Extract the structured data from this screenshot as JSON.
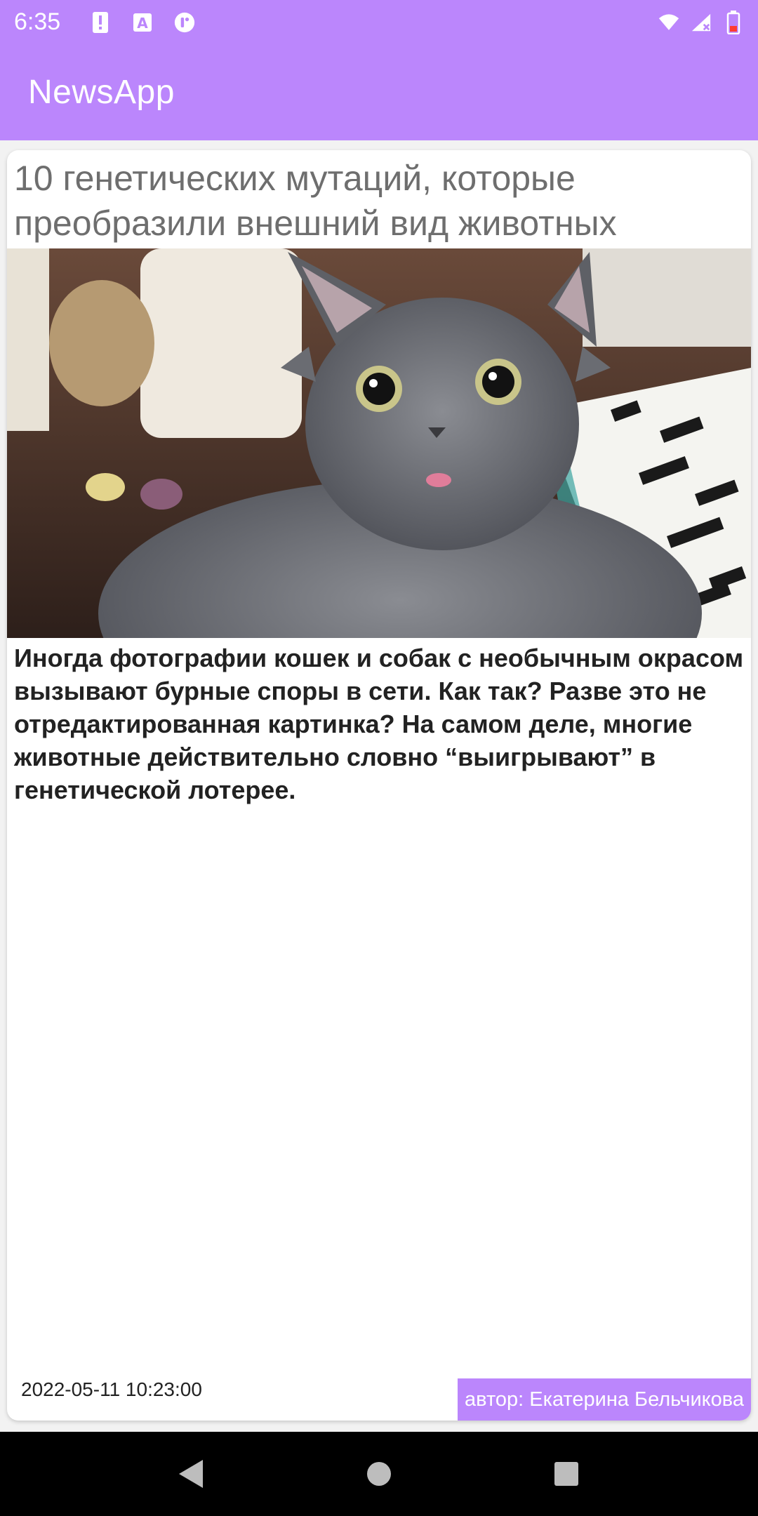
{
  "status_bar": {
    "time": "6:35",
    "icons_left": [
      "alert-icon",
      "a-box-icon",
      "toggle-icon"
    ],
    "icons_right": [
      "wifi-icon",
      "signal-icon",
      "battery-icon"
    ]
  },
  "app_bar": {
    "title": "NewsApp"
  },
  "article": {
    "title": "10 генетических мутаций, которые преобразили внешний вид животных",
    "image_icon": "gray-cat-photo",
    "body": "Иногда фотографии кошек и собак с необычным окрасом вызывают бурные споры в сети. Как так? Разве это не отредактированная картинка? На самом деле, многие животные действительно словно “выигрывают” в генетической лотерее.",
    "date": "2022-05-11 10:23:00",
    "author": "автор: Екатерина Бельчикова"
  },
  "nav_bar": {
    "icons": [
      "back-icon",
      "home-icon",
      "recents-icon"
    ]
  },
  "colors": {
    "accent": "#bb86fc",
    "nav": "#000000"
  }
}
